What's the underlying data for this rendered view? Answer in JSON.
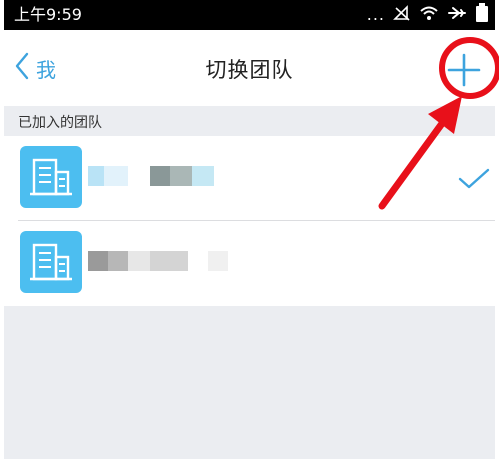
{
  "status_bar": {
    "time": "上午9:59",
    "dots": "...",
    "icons": [
      "signal-off-icon",
      "wifi-icon",
      "airplane-icon",
      "battery-icon"
    ]
  },
  "nav": {
    "back_label": "我",
    "title": "切换团队",
    "add_icon": "plus-icon"
  },
  "section": {
    "label": "已加入的团队"
  },
  "teams": [
    {
      "icon": "building-icon",
      "selected": true
    },
    {
      "icon": "building-icon",
      "selected": false
    }
  ],
  "colors": {
    "accent": "#3da3de",
    "avatar": "#4cbef0",
    "background": "#ebedf1",
    "annotation": "#e8101a"
  }
}
